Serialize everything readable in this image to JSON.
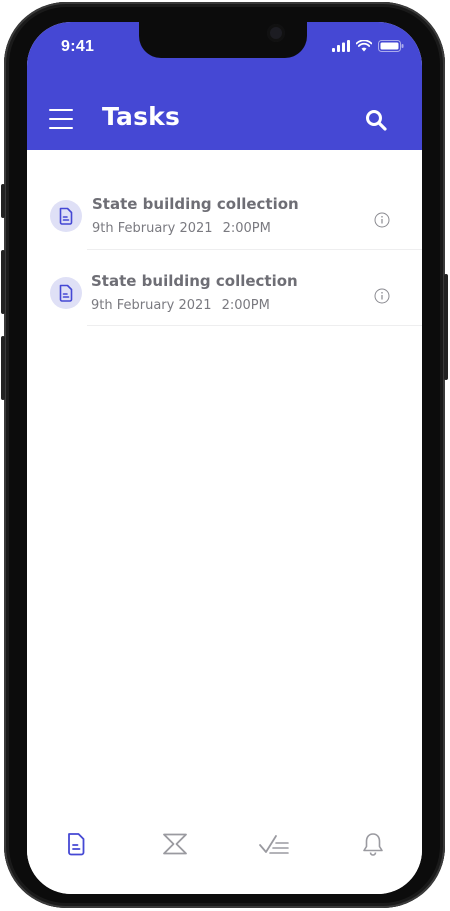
{
  "status_bar": {
    "time": "9:41"
  },
  "header": {
    "title": "Tasks"
  },
  "tasks": [
    {
      "title": "State building collection",
      "date": "9th February 2021",
      "time": "2:00PM"
    },
    {
      "title": "State building collection",
      "date": "9th February 2021",
      "time": "2:00PM"
    }
  ],
  "bottom_nav": {
    "items": [
      {
        "icon": "document-icon",
        "active": true
      },
      {
        "icon": "hourglass-icon",
        "active": false
      },
      {
        "icon": "checklist-icon",
        "active": false
      },
      {
        "icon": "bell-icon",
        "active": false
      }
    ]
  },
  "colors": {
    "accent": "#4548d4",
    "icon_bg": "#dfe0f6",
    "text_gray": "#6e6e75",
    "nav_inactive": "#9a9aa0"
  }
}
